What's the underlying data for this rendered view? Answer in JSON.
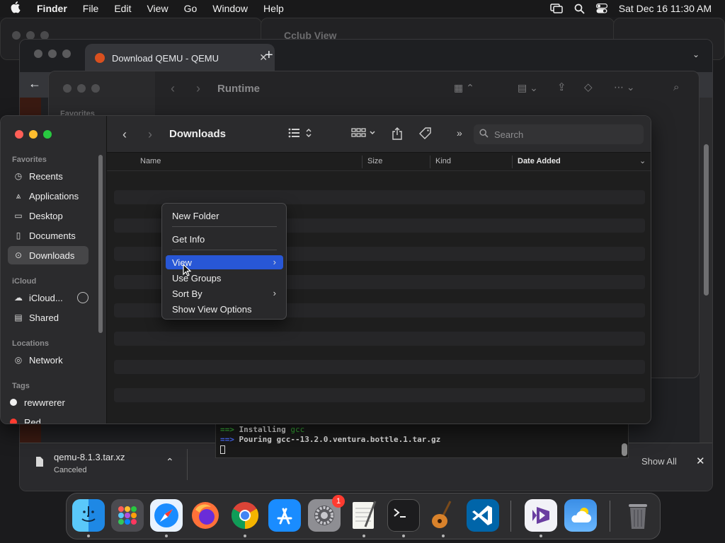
{
  "menubar": {
    "app_name": "Finder",
    "items": [
      "File",
      "Edit",
      "View",
      "Go",
      "Window",
      "Help"
    ],
    "clock": "Sat Dec 16  11:30 AM"
  },
  "chrome": {
    "tab_title": "Download QEMU - QEMU",
    "download": {
      "file_name": "qemu-8.1.3.tar.xz",
      "status": "Canceled",
      "show_all_label": "Show All"
    }
  },
  "behind_window": {
    "title": "Runtime",
    "peek_title": "Cclub View",
    "sidebar_peek": "Favorites"
  },
  "terminal": {
    "line1_prefix": "==>",
    "line1_text": "Installing ",
    "line1_pkg": "gcc",
    "line2_prefix": "==>",
    "line2_text": "Pouring gcc--13.2.0.ventura.bottle.1.tar.gz"
  },
  "finder": {
    "title": "Downloads",
    "search_placeholder": "Search",
    "sidebar": {
      "favorites_header": "Favorites",
      "favorites": [
        {
          "label": "Recents",
          "icon": "clock-icon"
        },
        {
          "label": "Applications",
          "icon": "applications-icon"
        },
        {
          "label": "Desktop",
          "icon": "desktop-icon"
        },
        {
          "label": "Documents",
          "icon": "document-icon"
        },
        {
          "label": "Downloads",
          "icon": "downloads-icon"
        }
      ],
      "icloud_header": "iCloud",
      "icloud": [
        {
          "label": "iCloud...",
          "icon": "cloud-icon"
        },
        {
          "label": "Shared",
          "icon": "shared-folder-icon"
        }
      ],
      "locations_header": "Locations",
      "locations": [
        {
          "label": "Network",
          "icon": "network-icon"
        }
      ],
      "tags_header": "Tags",
      "tags": [
        {
          "label": "rewwrerer",
          "color": "#f0f0f0"
        },
        {
          "label": "Red",
          "color": "#ff3b30"
        }
      ]
    },
    "columns": [
      "Name",
      "Size",
      "Kind",
      "Date Added"
    ]
  },
  "context_menu": {
    "items": [
      "New Folder",
      "Get Info",
      "View",
      "Use Groups",
      "Sort By",
      "Show View Options"
    ],
    "highlighted": "View"
  },
  "dock": {
    "apps": [
      "Finder",
      "Launchpad",
      "Safari",
      "Firefox",
      "Chrome",
      "App Store",
      "System Settings",
      "TextEdit",
      "Terminal",
      "GarageBand",
      "Visual Studio Code",
      "Visual Studio",
      "Weather",
      "Trash"
    ],
    "settings_badge": "1"
  },
  "colors": {
    "accent": "#2857d6",
    "tag_red": "#ff3b30"
  }
}
